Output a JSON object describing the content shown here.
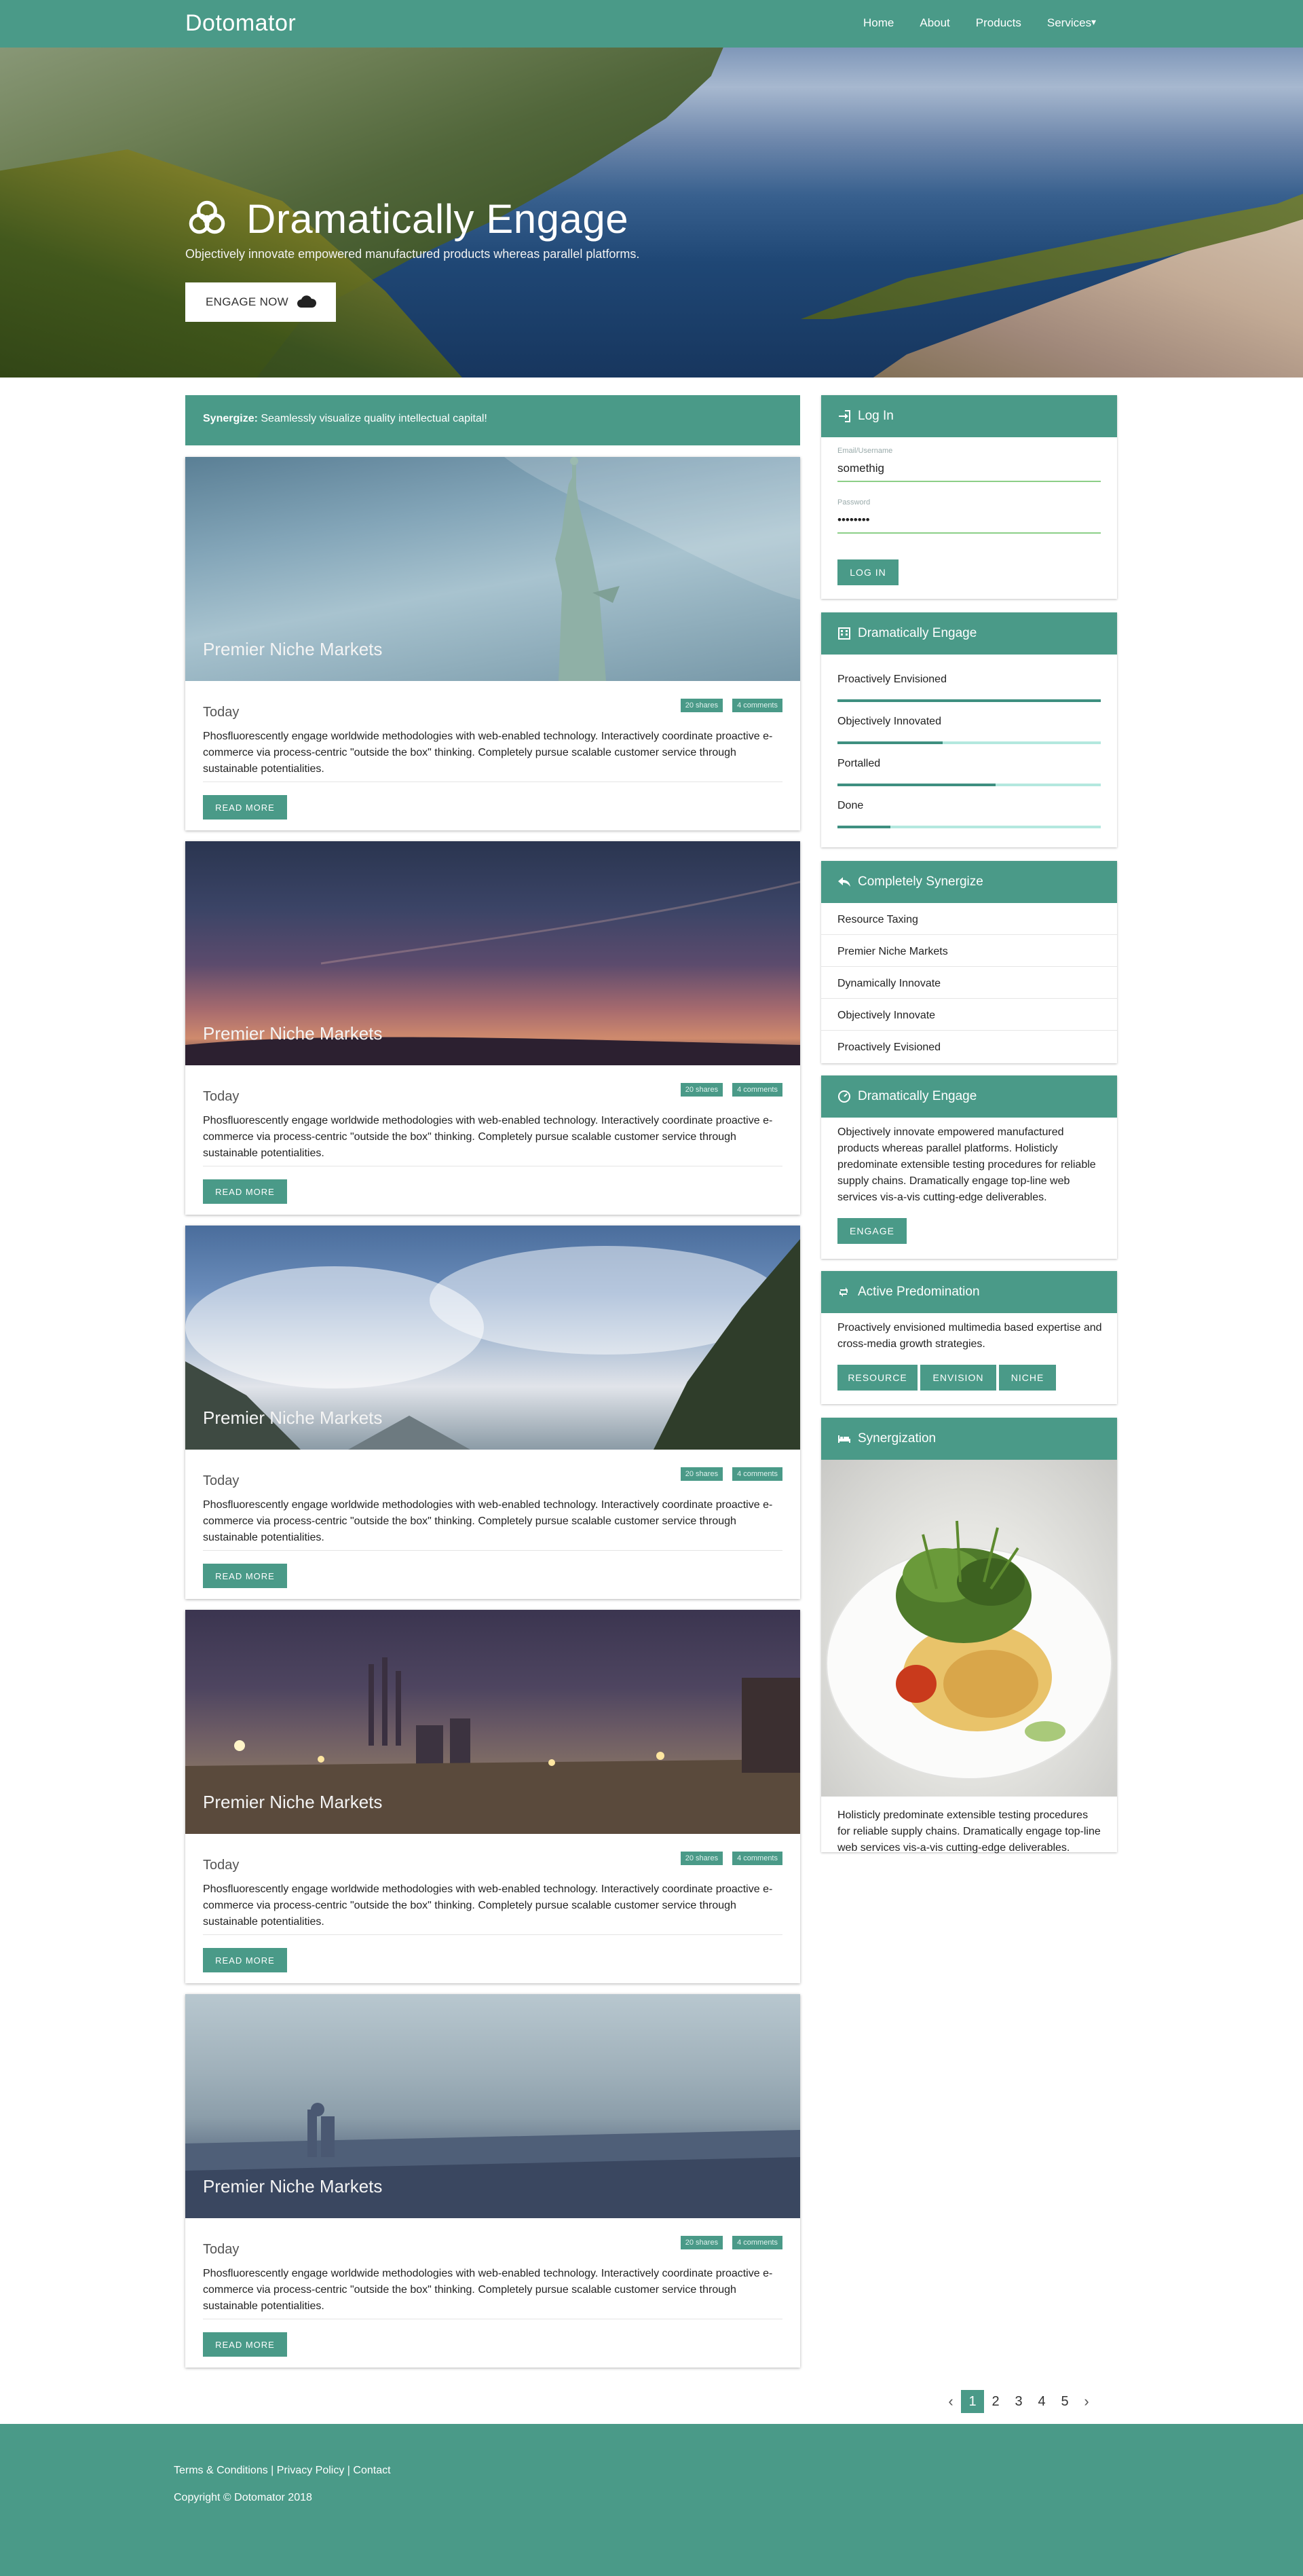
{
  "nav": {
    "brand": "Dotomator",
    "links": [
      "Home",
      "About",
      "Products",
      "Services"
    ],
    "caret": "▾"
  },
  "hero": {
    "title": "Dramatically Engage",
    "subtitle": "Objectively innovate empowered manufactured products whereas parallel platforms.",
    "button": "ENGAGE NOW"
  },
  "alert": {
    "strong": "Synergize:",
    "text": " Seamlessly visualize quality intellectual capital!"
  },
  "posts": [
    {
      "image_title": "Premier Niche Markets",
      "date": "Today",
      "shares": "20 shares",
      "comments": "4 comments",
      "text": "Phosfluorescently engage worldwide methodologies with web-enabled technology. Interactively coordinate proactive e-commerce via process-centric \"outside the box\" thinking. Completely pursue scalable customer service through sustainable potentialities.",
      "button": "READ MORE"
    },
    {
      "image_title": "Premier Niche Markets",
      "date": "Today",
      "shares": "20 shares",
      "comments": "4 comments",
      "text": "Phosfluorescently engage worldwide methodologies with web-enabled technology. Interactively coordinate proactive e-commerce via process-centric \"outside the box\" thinking. Completely pursue scalable customer service through sustainable potentialities.",
      "button": "READ MORE"
    },
    {
      "image_title": "Premier Niche Markets",
      "date": "Today",
      "shares": "20 shares",
      "comments": "4 comments",
      "text": "Phosfluorescently engage worldwide methodologies with web-enabled technology. Interactively coordinate proactive e-commerce via process-centric \"outside the box\" thinking. Completely pursue scalable customer service through sustainable potentialities.",
      "button": "READ MORE"
    },
    {
      "image_title": "Premier Niche Markets",
      "date": "Today",
      "shares": "20 shares",
      "comments": "4 comments",
      "text": "Phosfluorescently engage worldwide methodologies with web-enabled technology. Interactively coordinate proactive e-commerce via process-centric \"outside the box\" thinking. Completely pursue scalable customer service through sustainable potentialities.",
      "button": "READ MORE"
    },
    {
      "image_title": "Premier Niche Markets",
      "date": "Today",
      "shares": "20 shares",
      "comments": "4 comments",
      "text": "Phosfluorescently engage worldwide methodologies with web-enabled technology. Interactively coordinate proactive e-commerce via process-centric \"outside the box\" thinking. Completely pursue scalable customer service through sustainable potentialities.",
      "button": "READ MORE"
    }
  ],
  "login": {
    "title": "Log In",
    "email_label": "Email/Username",
    "email_value": "somethig",
    "password_label": "Password",
    "password_value": "••••••••",
    "button": "LOG IN"
  },
  "progress_panel": {
    "title": "Dramatically Engage",
    "items": [
      {
        "label": "Proactively Envisioned",
        "percent": 100
      },
      {
        "label": "Objectively Innovated",
        "percent": 40
      },
      {
        "label": "Portalled",
        "percent": 60
      },
      {
        "label": "Done",
        "percent": 20
      }
    ]
  },
  "list_panel": {
    "title": "Completely Synergize",
    "items": [
      "Resource Taxing",
      "Premier Niche Markets",
      "Dynamically Innovate",
      "Objectively Innovate",
      "Proactively Evisioned"
    ]
  },
  "engage_panel": {
    "title": "Dramatically Engage",
    "text": "Objectively innovate empowered manufactured products whereas parallel platforms. Holisticly predominate extensible testing procedures for reliable supply chains. Dramatically engage top-line web services vis-a-vis cutting-edge deliverables.",
    "button": "ENGAGE"
  },
  "predomination_panel": {
    "title": "Active Predomination",
    "text": "Proactively envisioned multimedia based expertise and cross-media growth strategies.",
    "buttons": [
      "RESOURCE",
      "ENVISION",
      "NICHE"
    ]
  },
  "synergization_panel": {
    "title": "Synergization",
    "text": "Holisticly predominate extensible testing procedures for reliable supply chains. Dramatically engage top-line web services vis-a-vis cutting-edge deliverables."
  },
  "pagination": {
    "prev": "‹",
    "pages": [
      "1",
      "2",
      "3",
      "4",
      "5"
    ],
    "active": "1",
    "next": "›"
  },
  "footer": {
    "links": "Terms & Conditions | Privacy Policy | Contact",
    "copyright": "Copyright © Dotomator 2018"
  },
  "colors": {
    "primary": "#4a9a88",
    "progress_track": "#b4e8df",
    "input_underline": "#8ccf87"
  }
}
